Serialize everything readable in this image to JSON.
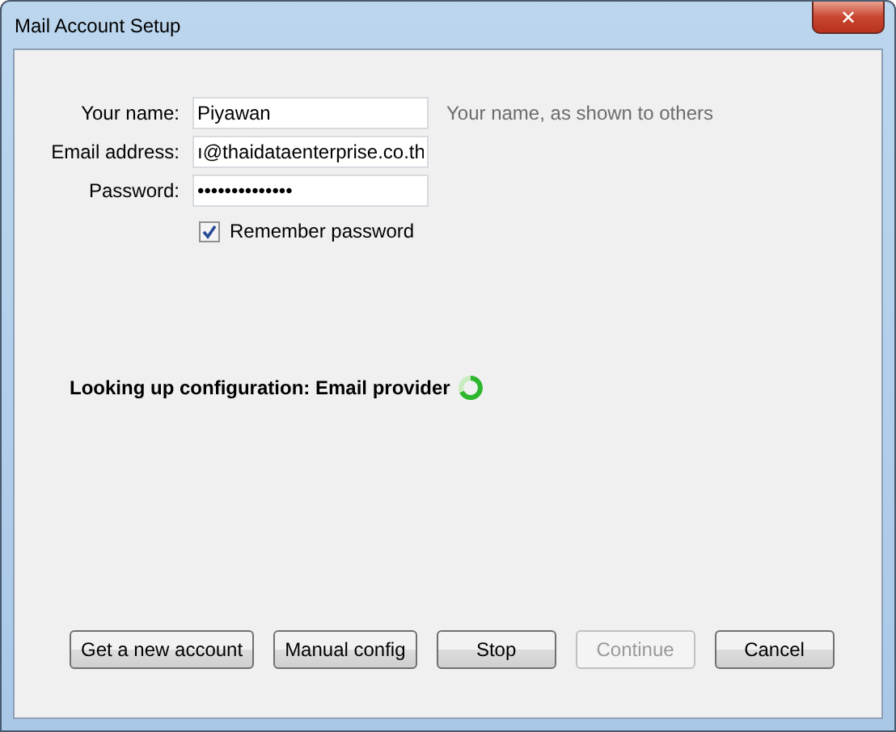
{
  "window": {
    "title": "Mail Account Setup",
    "close_icon": "✕"
  },
  "fields": [
    {
      "label": "Your name:",
      "value": "Piyawan",
      "hint": "Your name, as shown to others"
    },
    {
      "label": "Email address:",
      "value": "ı@thaidataenterprise.co.th"
    },
    {
      "label": "Password:",
      "value": "••••••••••••••"
    }
  ],
  "remember_password": {
    "label": "Remember password",
    "checked": true
  },
  "status": {
    "text": "Looking up configuration: Email provider",
    "busy": true
  },
  "buttons": [
    {
      "label": "Get a new account",
      "disabled": false
    },
    {
      "label": "Manual config",
      "disabled": false
    },
    {
      "label": "Stop",
      "disabled": false
    },
    {
      "label": "Continue",
      "disabled": true
    },
    {
      "label": "Cancel",
      "disabled": false
    }
  ]
}
